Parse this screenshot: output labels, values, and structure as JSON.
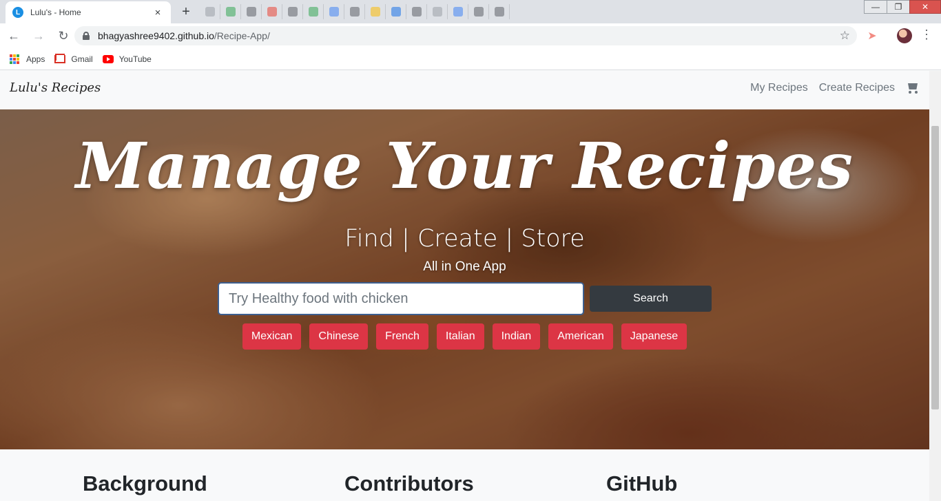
{
  "browser": {
    "tab_title": "Lulu's - Home",
    "tab_favicon_letter": "L",
    "tab_close": "×",
    "new_tab": "+",
    "url_host": "bhagyashree9402.github.io",
    "url_path": "/Recipe-App/",
    "bookmarks": [
      {
        "label": "Apps",
        "icon": "apps-icon"
      },
      {
        "label": "Gmail",
        "icon": "gmail-icon"
      },
      {
        "label": "YouTube",
        "icon": "youtube-icon"
      }
    ]
  },
  "site": {
    "brand": "Lulu's Recipes",
    "nav": {
      "my_recipes": "My Recipes",
      "create_recipes": "Create Recipes"
    }
  },
  "hero": {
    "title": "Manage Your Recipes",
    "subtitle": "Find | Create | Store",
    "tagline": "All in One App",
    "search_placeholder": "Try Healthy food with chicken",
    "search_button": "Search",
    "cuisines": [
      "Mexican",
      "Chinese",
      "French",
      "Italian",
      "Indian",
      "American",
      "Japanese"
    ]
  },
  "sections": {
    "background": "Background",
    "contributors": "Contributors",
    "github": "GitHub"
  },
  "colors": {
    "accent_red": "#dc3545",
    "dark_button": "#343a40",
    "nav_text": "#6c757d"
  }
}
